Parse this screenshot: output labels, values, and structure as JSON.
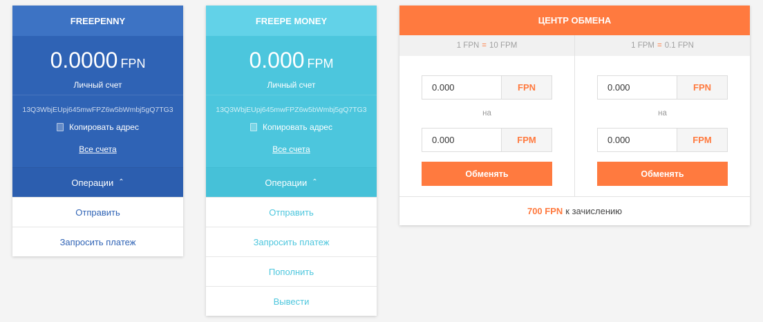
{
  "colors": {
    "freepenny_accent": "#2f63b5",
    "freepe_accent": "#4cc6dd",
    "exchange_accent": "#ff7a3f"
  },
  "wallets": [
    {
      "title": "FREEPENNY",
      "amount": "0.0000",
      "unit": "FPN",
      "balance_label": "Личный счет",
      "address": "13Q3WbjEUpj645mwFPZ6w5bWmbj5gQ7TG3",
      "copy_label": "Копировать адрес",
      "all_accounts": "Все счета",
      "operations_label": "Операции",
      "actions": [
        "Отправить",
        "Запросить платеж"
      ]
    },
    {
      "title": "FREEPE MONEY",
      "amount": "0.000",
      "unit": "FPM",
      "balance_label": "Личный счет",
      "address": "13Q3WbjEUpj645mwFPZ6w5bWmbj5gQ7TG3",
      "copy_label": "Копировать адрес",
      "all_accounts": "Все счета",
      "operations_label": "Операции",
      "actions": [
        "Отправить",
        "Запросить платеж",
        "Пополнить",
        "Вывести"
      ]
    }
  ],
  "exchange": {
    "title": "ЦЕНТР ОБМЕНА",
    "columns": [
      {
        "rate_left": "1 FPN",
        "rate_eq": "=",
        "rate_right": "10 FPM",
        "from_value": "0.000",
        "from_currency": "FPN",
        "on_label": "на",
        "to_value": "0.000",
        "to_currency": "FPM",
        "button": "Обменять"
      },
      {
        "rate_left": "1 FPM",
        "rate_eq": "=",
        "rate_right": "0.1 FPN",
        "from_value": "0.000",
        "from_currency": "FPN",
        "on_label": "на",
        "to_value": "0.000",
        "to_currency": "FPM",
        "button": "Обменять"
      }
    ],
    "footer_amount": "700 FPN",
    "footer_text": "к зачислению"
  }
}
